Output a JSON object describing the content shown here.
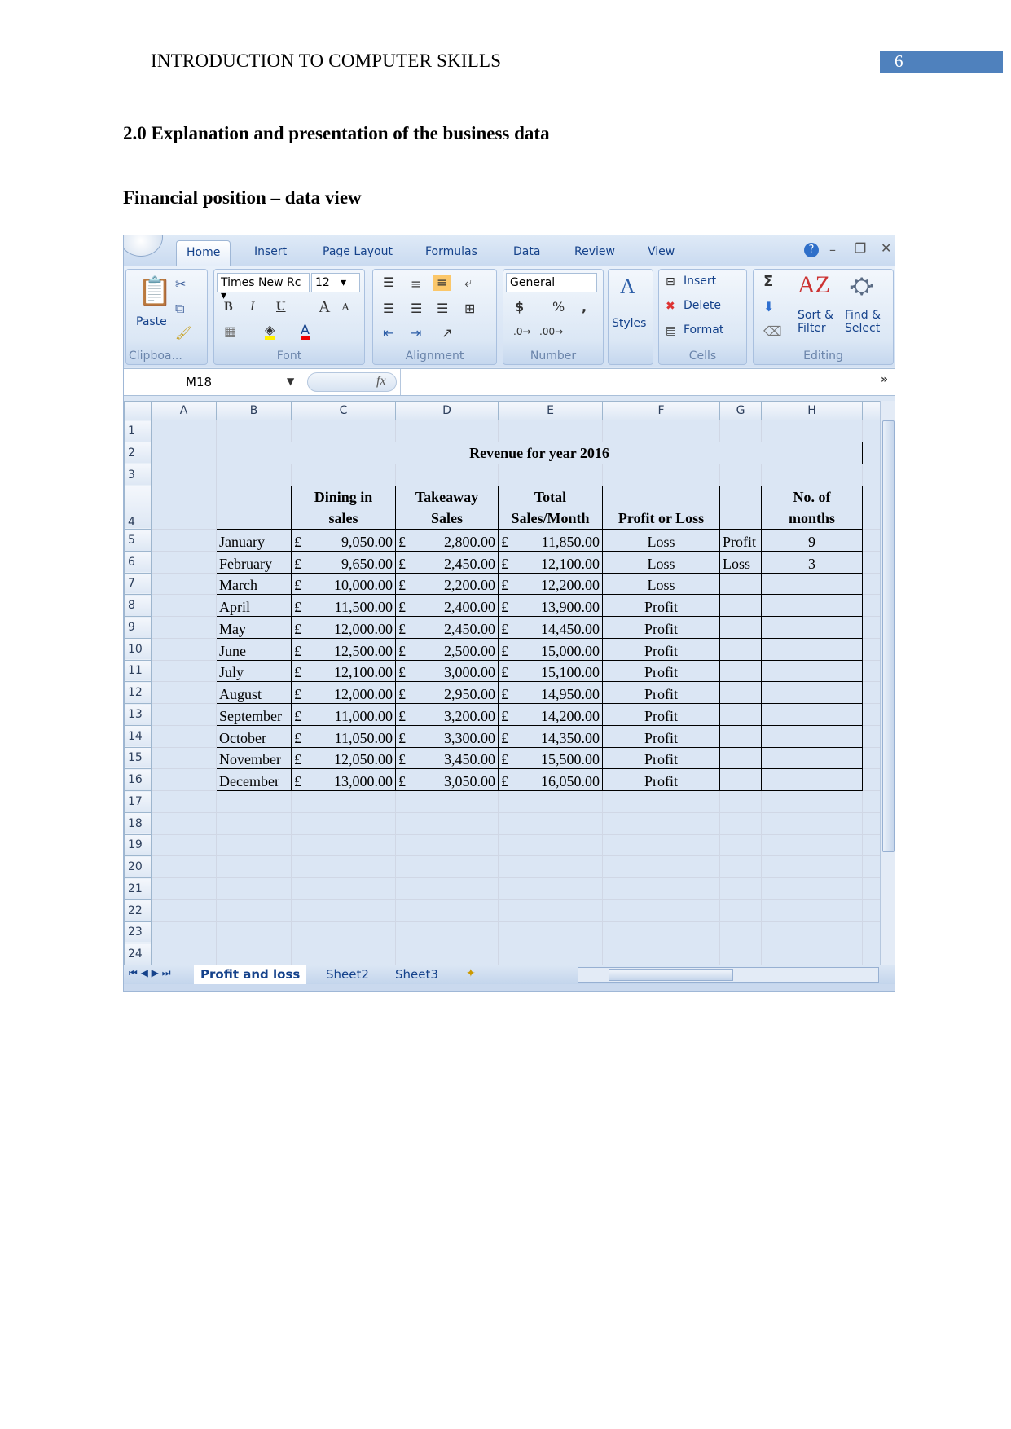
{
  "page": {
    "running_header": "INTRODUCTION TO COMPUTER SKILLS",
    "page_number": "6",
    "accent": "#4f81bd",
    "heading": "2.0 Explanation and presentation of the business data",
    "subheading": "Financial position – data view"
  },
  "excel": {
    "tabs": [
      "Home",
      "Insert",
      "Page Layout",
      "Formulas",
      "Data",
      "Review",
      "View"
    ],
    "groups": {
      "clipboard": "Clipboa...",
      "font": "Font",
      "alignment": "Alignment",
      "number": "Number",
      "cells": "Cells",
      "editing": "Editing"
    },
    "paste": "Paste",
    "font_name": "Times New Rc",
    "font_size": "12",
    "number_format": "General",
    "styles": "Styles",
    "cells_insert": "Insert",
    "cells_delete": "Delete",
    "cells_format": "Format",
    "sort_filter_1": "Sort &",
    "sort_filter_2": "Filter",
    "find_select_1": "Find &",
    "find_select_2": "Select",
    "name_box": "M18",
    "fx": "fx",
    "formula": "",
    "columns": [
      "A",
      "B",
      "C",
      "D",
      "E",
      "F",
      "G",
      "H"
    ],
    "title": "Revenue for year 2016",
    "headers": [
      "",
      "Dining in\nsales",
      "Takeaway\nSales",
      "Total\nSales/Month",
      "Profit or Loss",
      "",
      "No. of\nmonths"
    ],
    "currency": "£",
    "rows": [
      [
        "January",
        "9,050.00",
        "2,800.00",
        "11,850.00",
        "Loss",
        "Profit",
        "9"
      ],
      [
        "February",
        "9,650.00",
        "2,450.00",
        "12,100.00",
        "Loss",
        "Loss",
        "3"
      ],
      [
        "March",
        "10,000.00",
        "2,200.00",
        "12,200.00",
        "Loss",
        "",
        ""
      ],
      [
        "April",
        "11,500.00",
        "2,400.00",
        "13,900.00",
        "Profit",
        "",
        ""
      ],
      [
        "May",
        "12,000.00",
        "2,450.00",
        "14,450.00",
        "Profit",
        "",
        ""
      ],
      [
        "June",
        "12,500.00",
        "2,500.00",
        "15,000.00",
        "Profit",
        "",
        ""
      ],
      [
        "July",
        "12,100.00",
        "3,000.00",
        "15,100.00",
        "Profit",
        "",
        ""
      ],
      [
        "August",
        "12,000.00",
        "2,950.00",
        "14,950.00",
        "Profit",
        "",
        ""
      ],
      [
        "September",
        "11,000.00",
        "3,200.00",
        "14,200.00",
        "Profit",
        "",
        ""
      ],
      [
        "October",
        "11,050.00",
        "3,300.00",
        "14,350.00",
        "Profit",
        "",
        ""
      ],
      [
        "November",
        "12,050.00",
        "3,450.00",
        "15,500.00",
        "Profit",
        "",
        ""
      ],
      [
        "December",
        "13,000.00",
        "3,050.00",
        "16,050.00",
        "Profit",
        "",
        ""
      ]
    ],
    "row_count": 24,
    "sheets": [
      "Profit and loss",
      "Sheet2",
      "Sheet3"
    ]
  }
}
